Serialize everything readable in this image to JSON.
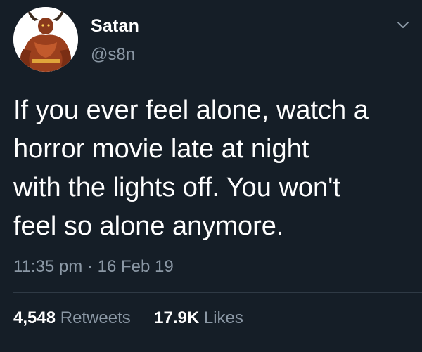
{
  "user": {
    "name": "Satan",
    "handle": "@s8n"
  },
  "tweet": {
    "text": "If you ever feel alone, watch a\nhorror movie late at night\nwith the lights off. You won't\nfeel so alone anymore.",
    "time": "11:35 pm",
    "separator": "·",
    "date": "16 Feb 19"
  },
  "stats": {
    "retweets_count": "4,548",
    "retweets_label": "Retweets",
    "likes_count": "17.9K",
    "likes_label": "Likes"
  },
  "icons": {
    "menu": "chevron-down-icon"
  },
  "colors": {
    "background": "#151e27",
    "primary_text": "#ffffff",
    "secondary_text": "#8b98a5",
    "divider": "#2f3a45"
  }
}
